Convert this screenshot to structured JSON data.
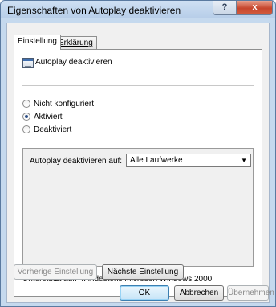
{
  "window": {
    "title": "Eigenschaften von Autoplay deaktivieren",
    "help_label": "?",
    "close_label": "x"
  },
  "tabs": [
    {
      "label": "Einstellung"
    },
    {
      "label": "Erklärung"
    }
  ],
  "policy": {
    "name": "Autoplay deaktivieren"
  },
  "radios": [
    {
      "label": "Nicht konfiguriert",
      "checked": false
    },
    {
      "label": "Aktiviert",
      "checked": true
    },
    {
      "label": "Deaktiviert",
      "checked": false
    }
  ],
  "option": {
    "label": "Autoplay deaktivieren auf:",
    "selected": "Alle Laufwerke"
  },
  "supported": {
    "label": "Unterstützt auf:",
    "value": "Mindestens Microsoft Windows 2000"
  },
  "nav": {
    "previous_label": "Vorherige Einstellung",
    "next_label": "Nächste Einstellung"
  },
  "buttons": {
    "ok_label": "OK",
    "cancel_label": "Abbrechen",
    "apply_label": "Übernehmen"
  },
  "icons": {
    "policy_icon": "policy-setting-icon",
    "dropdown_icon": "chevron-down-icon"
  }
}
